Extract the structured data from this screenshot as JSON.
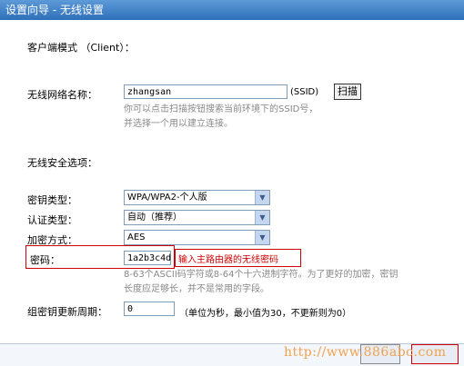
{
  "window": {
    "title": "设置向导 - 无线设置"
  },
  "mode": {
    "label": "客户端模式 （Client）："
  },
  "ssid": {
    "label": "无线网络名称：",
    "value": "zhangsan",
    "suffix": "(SSID)",
    "scan_button": "扫描",
    "hint_line1": "你可以点击扫描按钮搜索当前环境下的SSID号，",
    "hint_line2": "并选择一个用以建立连接。"
  },
  "security": {
    "section_label": "无线安全选项：",
    "key_type": {
      "label": "密钥类型：",
      "value": "WPA/WPA2-个人版"
    },
    "auth_type": {
      "label": "认证类型：",
      "value": "自动（推荐）"
    },
    "encryption": {
      "label": "加密方式：",
      "value": "AES"
    },
    "password": {
      "label": "密码：",
      "value": "1a2b3c4d",
      "annotation": "输入主路由器的无线密码",
      "hint_line1": "8-63个ASCII码字符或8-64个十六进制字符。为了更好的加密，密钥",
      "hint_line2": "长度应足够长，并不是常用的字段。"
    },
    "renew": {
      "label": "组密钥更新周期：",
      "value": "0",
      "note": "（单位为秒，最小值为30，不更新则为0）"
    }
  },
  "watermark": "http://www.886abc.com",
  "colors": {
    "title_bar": "#3a7cc4",
    "annotation_red": "#d00000",
    "watermark": "#f0a24c"
  }
}
